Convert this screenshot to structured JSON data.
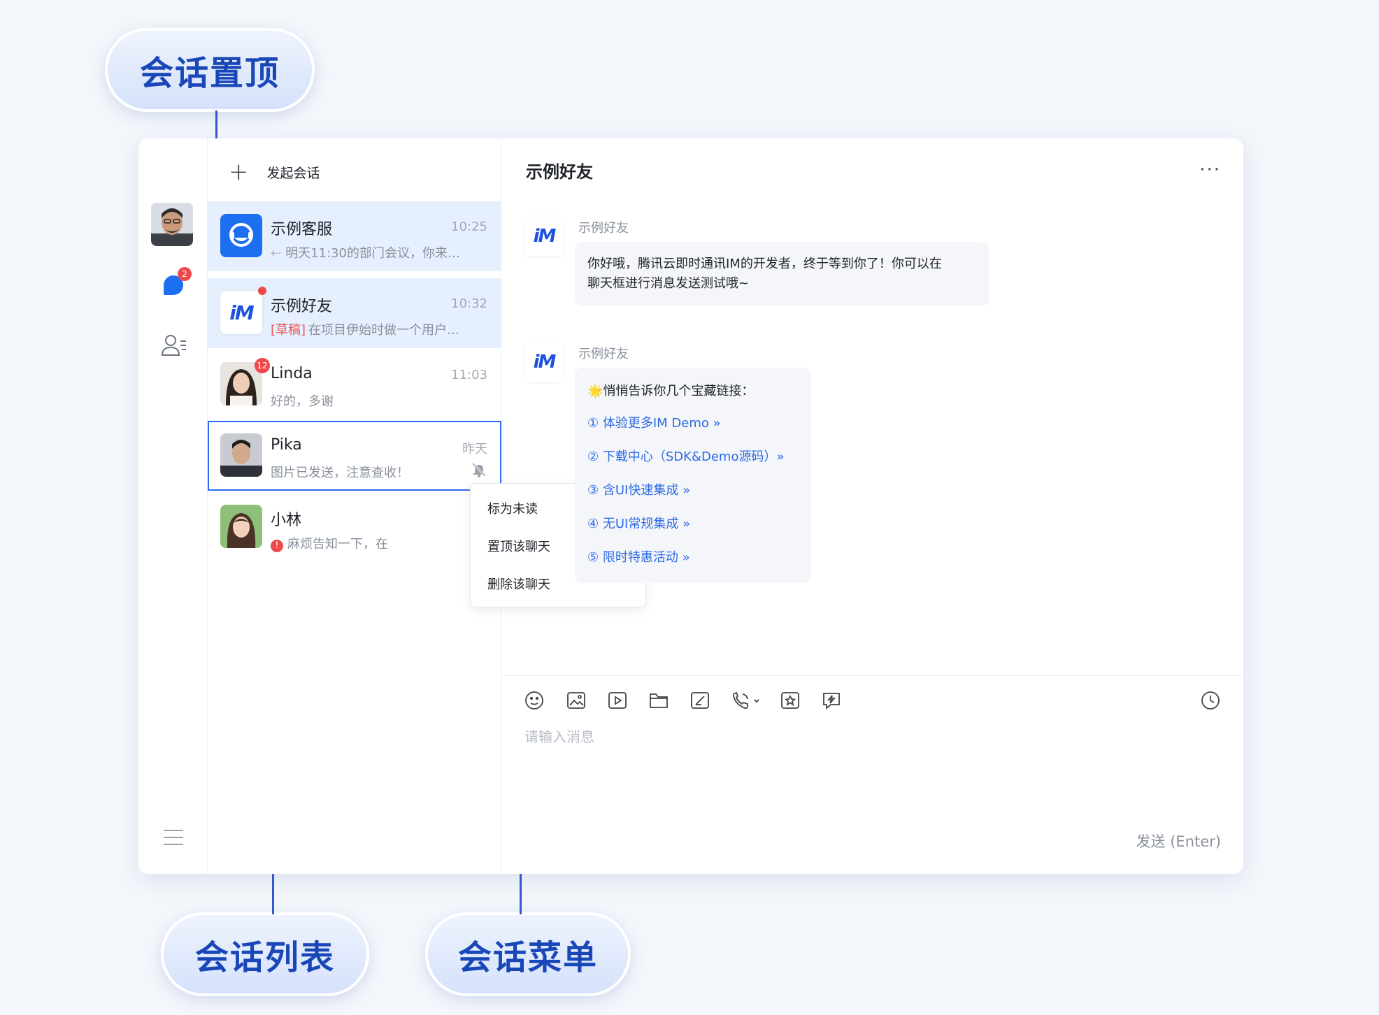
{
  "callouts": {
    "pin_conversation": "会话置顶",
    "conversation_list": "会话列表",
    "conversation_menu": "会话菜单"
  },
  "rail": {
    "unread_badge": "2",
    "icons": [
      "avatar",
      "chat-icon",
      "contacts-icon",
      "menu-icon"
    ]
  },
  "conversation_panel": {
    "new_conversation": "发起会话",
    "items": [
      {
        "name": "示例客服",
        "time": "10:25",
        "preview": "明天11:30的部门会议，你来…"
      },
      {
        "name": "示例好友",
        "time": "10:32",
        "draft_tag": "[草稿]",
        "preview": "在项目伊始时做一个用户…"
      },
      {
        "name": "Linda",
        "time": "11:03",
        "preview": "好的，多谢",
        "badge": "12"
      },
      {
        "name": "Pika",
        "time": "昨天",
        "preview": "图片已发送，注意查收！"
      },
      {
        "name": "小林",
        "time": "",
        "preview": "麻烦告知一下，在"
      }
    ]
  },
  "context_menu": {
    "items": [
      "标为未读",
      "置顶该聊天",
      "删除该聊天"
    ]
  },
  "chat": {
    "title": "示例好友",
    "more": "···",
    "logo_text": "iM",
    "messages": [
      {
        "sender": "示例好友",
        "text_line1": "你好哦，腾讯云即时通讯IM的开发者，终于等到你了！你可以在",
        "text_line2": "聊天框进行消息发送测试哦~"
      },
      {
        "sender": "示例好友",
        "intro": "🌟悄悄告诉你几个宝藏链接：",
        "links": [
          "① 体验更多IM Demo »",
          "② 下载中心（SDK&Demo源码）»",
          "③ 含UI快速集成 »",
          "④ 无UI常规集成 »",
          "⑤ 限时特惠活动 »"
        ]
      }
    ],
    "input_placeholder": "请输入消息",
    "send_label": "发送 (Enter)"
  },
  "colors": {
    "accent": "#2e5bd3",
    "link": "#2d6ae6",
    "badge": "#f04848",
    "selected_bg": "#e6effd"
  }
}
